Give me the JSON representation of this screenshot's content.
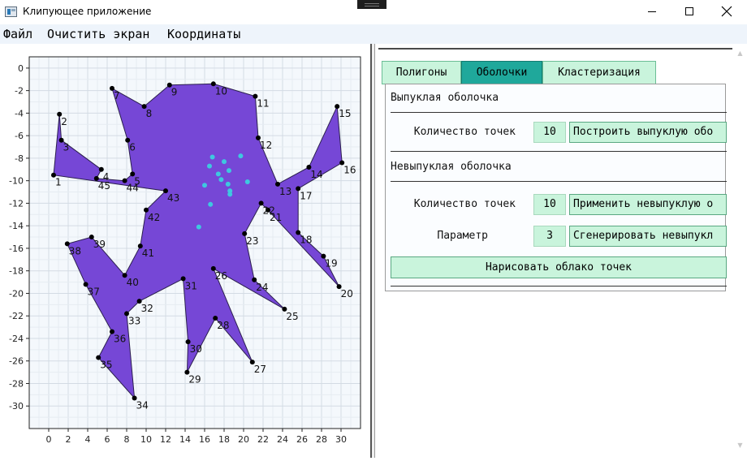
{
  "window": {
    "title": "Клипующее приложение",
    "controls": {
      "minimize": "minimize",
      "maximize": "maximize",
      "close": "close"
    }
  },
  "menu": [
    "Файл",
    "Очистить экран",
    "Координаты"
  ],
  "tabs": [
    {
      "label": "Полигоны",
      "active": false
    },
    {
      "label": "Оболочки",
      "active": true
    },
    {
      "label": "Кластеризация",
      "active": false
    }
  ],
  "panel": {
    "convex": {
      "title": "Выпуклая оболочка",
      "count_label": "Количество точек",
      "count_value": "10",
      "build_button": "Построить выпуклую обо"
    },
    "concave": {
      "title": "Невыпуклая оболочка",
      "count_label": "Количество точек",
      "count_value": "10",
      "apply_button": "Применить невыпуклую о",
      "param_label": "Параметр",
      "param_value": "3",
      "generate_button": "Сгенерировать невыпукл"
    },
    "draw_cloud_button": "Нарисовать облако точек"
  },
  "colors": {
    "polygon_fill": "#7647d6",
    "polygon_stroke": "#2b1f4d",
    "vertex": "#000000",
    "cloud_point": "#3ec8e0",
    "plot_bg": "#f4f8fc",
    "tab_bg": "#c9f4dc",
    "tab_active_bg": "#1fa89b"
  },
  "chart_data": {
    "type": "scatter",
    "xlim": [
      -2,
      32
    ],
    "ylim": [
      -32,
      1
    ],
    "x_ticks": [
      0,
      2,
      4,
      6,
      8,
      10,
      12,
      14,
      16,
      18,
      20,
      22,
      24,
      26,
      28,
      30
    ],
    "y_ticks": [
      0,
      -2,
      -4,
      -6,
      -8,
      -10,
      -12,
      -14,
      -16,
      -18,
      -20,
      -22,
      -24,
      -26,
      -28,
      -30
    ],
    "grid": true,
    "polygon": [
      {
        "label": "1",
        "x": 0.5,
        "y": -9.5
      },
      {
        "label": "2",
        "x": 1.1,
        "y": -4.1
      },
      {
        "label": "3",
        "x": 1.3,
        "y": -6.4
      },
      {
        "label": "4",
        "x": 5.4,
        "y": -9.0
      },
      {
        "label": "45",
        "x": 4.9,
        "y": -9.8
      },
      {
        "label": "44",
        "x": 7.8,
        "y": -10.0
      },
      {
        "label": "5",
        "x": 8.6,
        "y": -9.4
      },
      {
        "label": "6",
        "x": 8.1,
        "y": -6.4
      },
      {
        "label": "7",
        "x": 6.5,
        "y": -1.8
      },
      {
        "label": "8",
        "x": 9.8,
        "y": -3.4
      },
      {
        "label": "9",
        "x": 12.4,
        "y": -1.5
      },
      {
        "label": "10",
        "x": 16.9,
        "y": -1.4
      },
      {
        "label": "11",
        "x": 21.2,
        "y": -2.5
      },
      {
        "label": "12",
        "x": 21.5,
        "y": -6.2
      },
      {
        "label": "13",
        "x": 23.5,
        "y": -10.3
      },
      {
        "label": "14",
        "x": 26.7,
        "y": -8.8
      },
      {
        "label": "15",
        "x": 29.6,
        "y": -3.4
      },
      {
        "label": "16",
        "x": 30.1,
        "y": -8.4
      },
      {
        "label": "17",
        "x": 25.6,
        "y": -10.7
      },
      {
        "label": "18",
        "x": 25.6,
        "y": -14.6
      },
      {
        "label": "19",
        "x": 28.2,
        "y": -16.7
      },
      {
        "label": "20",
        "x": 29.8,
        "y": -19.4
      },
      {
        "label": "21",
        "x": 22.5,
        "y": -12.6
      },
      {
        "label": "22",
        "x": 21.8,
        "y": -12.0
      },
      {
        "label": "23",
        "x": 20.1,
        "y": -14.7
      },
      {
        "label": "24",
        "x": 21.1,
        "y": -18.8
      },
      {
        "label": "25",
        "x": 24.2,
        "y": -21.4
      },
      {
        "label": "26",
        "x": 16.9,
        "y": -17.8
      },
      {
        "label": "27",
        "x": 20.9,
        "y": -26.1
      },
      {
        "label": "28",
        "x": 17.1,
        "y": -22.2
      },
      {
        "label": "29",
        "x": 14.2,
        "y": -27.0
      },
      {
        "label": "30",
        "x": 14.3,
        "y": -24.3
      },
      {
        "label": "31",
        "x": 13.8,
        "y": -18.7
      },
      {
        "label": "32",
        "x": 9.3,
        "y": -20.7
      },
      {
        "label": "33",
        "x": 8.0,
        "y": -21.8
      },
      {
        "label": "34",
        "x": 8.8,
        "y": -29.3
      },
      {
        "label": "35",
        "x": 5.1,
        "y": -25.7
      },
      {
        "label": "36",
        "x": 6.5,
        "y": -23.4
      },
      {
        "label": "37",
        "x": 3.8,
        "y": -19.2
      },
      {
        "label": "38",
        "x": 1.9,
        "y": -15.6
      },
      {
        "label": "39",
        "x": 4.4,
        "y": -15.0
      },
      {
        "label": "40",
        "x": 7.8,
        "y": -18.4
      },
      {
        "label": "41",
        "x": 9.4,
        "y": -15.8
      },
      {
        "label": "42",
        "x": 10.0,
        "y": -12.6
      },
      {
        "label": "43",
        "x": 12.0,
        "y": -10.9
      }
    ],
    "cloud": [
      {
        "x": 16.8,
        "y": -7.9
      },
      {
        "x": 18.0,
        "y": -8.3
      },
      {
        "x": 19.7,
        "y": -7.8
      },
      {
        "x": 16.5,
        "y": -8.7
      },
      {
        "x": 18.5,
        "y": -9.1
      },
      {
        "x": 17.4,
        "y": -9.4
      },
      {
        "x": 17.7,
        "y": -9.9
      },
      {
        "x": 16.0,
        "y": -10.4
      },
      {
        "x": 18.4,
        "y": -10.3
      },
      {
        "x": 20.4,
        "y": -10.1
      },
      {
        "x": 18.6,
        "y": -10.9
      },
      {
        "x": 18.6,
        "y": -11.2
      },
      {
        "x": 16.6,
        "y": -12.1
      },
      {
        "x": 15.4,
        "y": -14.1
      }
    ]
  }
}
